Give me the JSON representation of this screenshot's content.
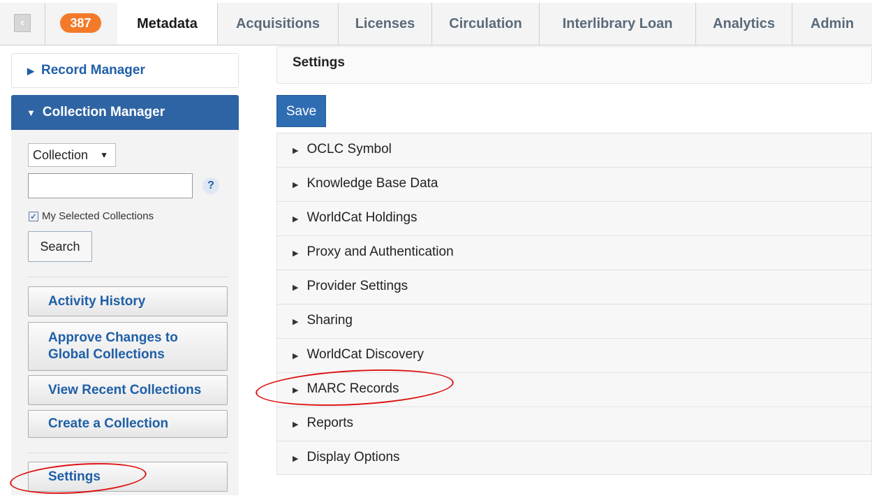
{
  "top_tabs": {
    "collapse_glyph": "‹",
    "badge_count": "387",
    "items": [
      {
        "label": "Metadata",
        "active": true
      },
      {
        "label": "Acquisitions",
        "active": false
      },
      {
        "label": "Licenses",
        "active": false
      },
      {
        "label": "Circulation",
        "active": false
      },
      {
        "label": "Interlibrary Loan",
        "active": false
      },
      {
        "label": "Analytics",
        "active": false
      },
      {
        "label": "Admin",
        "active": false
      }
    ]
  },
  "sidebar": {
    "record_manager": "Record Manager",
    "collection_manager": "Collection Manager",
    "search_type": "Collection",
    "search_value": "",
    "help_glyph": "?",
    "my_selected_label": "My Selected Collections",
    "my_selected_checked": true,
    "search_button": "Search",
    "buttons": {
      "activity_history": "Activity History",
      "approve_changes_line1": "Approve Changes to",
      "approve_changes_line2": "Global Collections",
      "view_recent": "View Recent Collections",
      "create_collection": "Create a Collection",
      "settings": "Settings"
    }
  },
  "main": {
    "title": "Settings",
    "save_button": "Save",
    "sections": [
      "OCLC Symbol",
      "Knowledge Base Data",
      "WorldCat Holdings",
      "Proxy and Authentication",
      "Provider Settings",
      "Sharing",
      "WorldCat Discovery",
      "MARC Records",
      "Reports",
      "Display Options"
    ]
  },
  "colors": {
    "accent_blue": "#2f64a4",
    "badge_orange": "#f47a2a",
    "highlight_circle": "#dd1111"
  }
}
